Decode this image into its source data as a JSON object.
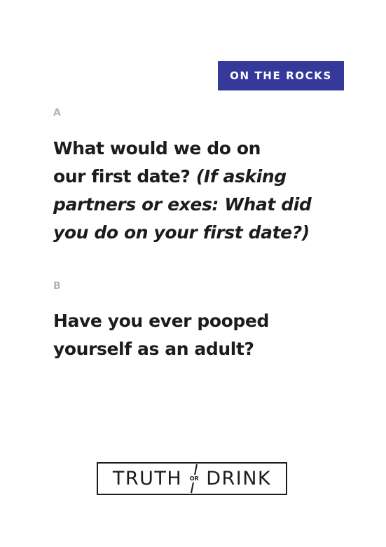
{
  "badge": {
    "label": "ON THE ROCKS",
    "color": "#35399a"
  },
  "card": {
    "a": {
      "letter": "A",
      "lines_regular": [
        "What would we do on",
        "our first date?"
      ],
      "italic_inline": "(If asking",
      "italic_lines": [
        "partners or exes: What did",
        "you do on your first date?)"
      ]
    },
    "b": {
      "letter": "B",
      "lines": [
        "Have you ever pooped",
        "yourself as an adult?"
      ]
    }
  },
  "logo": {
    "left_word": "TRUTH",
    "middle_word": "OR",
    "right_word": "DRINK"
  }
}
